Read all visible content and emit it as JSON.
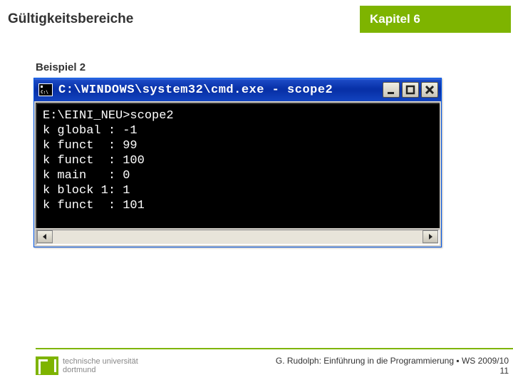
{
  "header": {
    "topic": "Gültigkeitsbereiche",
    "chapter": "Kapitel 6"
  },
  "subtitle": "Beispiel 2",
  "cmd": {
    "title": "C:\\WINDOWS\\system32\\cmd.exe - scope2",
    "icon_label": "C:\\",
    "lines": [
      "E:\\EINI_NEU>scope2",
      "k global : -1",
      "k funct  : 99",
      "k funct  : 100",
      "k main   : 0",
      "k block 1: 1",
      "k funct  : 101"
    ]
  },
  "footer": {
    "uni_line1": "technische universität",
    "uni_line2": "dortmund",
    "credit": "G. Rudolph: Einführung in die Programmierung ▪ WS 2009/10",
    "page": "11"
  }
}
